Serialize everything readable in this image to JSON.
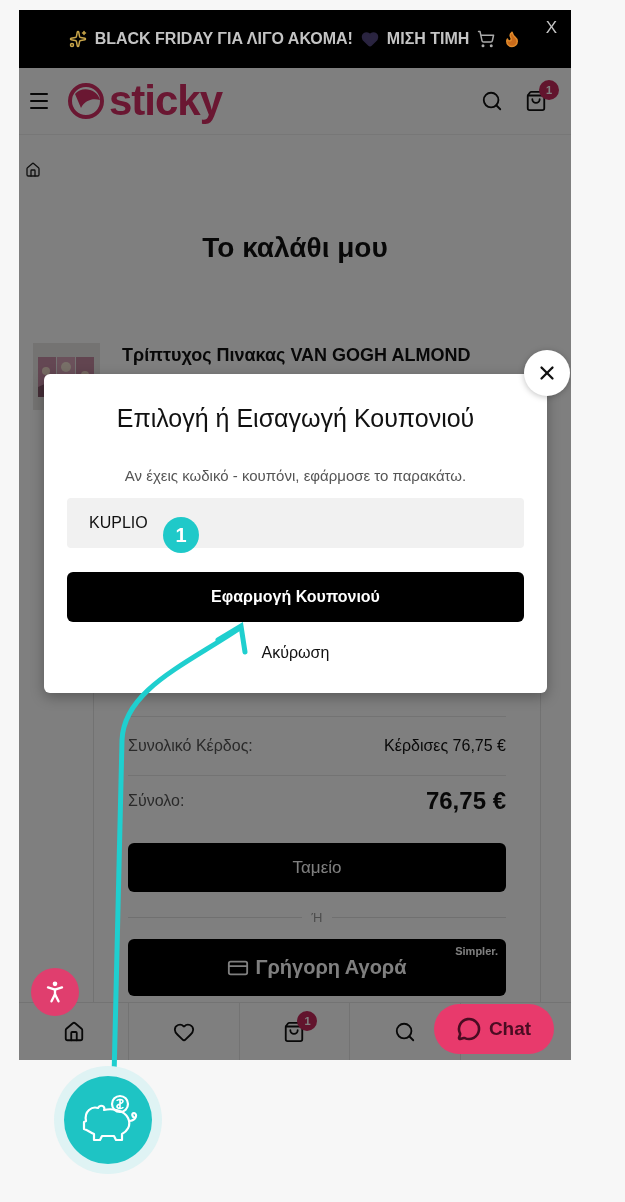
{
  "announcement": {
    "text": "BLACK FRIDAY ΓΙΑ ΛΙΓΟ ΑΚΟΜΑ!",
    "text_2": "ΜΙΣΗ ΤΙΜΗ",
    "close": "X"
  },
  "header": {
    "logo": "sticky",
    "cart_count": "1"
  },
  "page_title": "Το καλάθι μου",
  "product": {
    "title": "Τρίπτυχος Πινακας VAN GOGH ALMOND"
  },
  "summary": {
    "rows": [
      {
        "kind": "saving",
        "label": "Συνολικό Κέρδος:",
        "value": "Κέρδισες 76,75 €"
      },
      {
        "kind": "total",
        "label": "Σύνολο:",
        "value": "76,75 €"
      }
    ],
    "checkout": "Ταμείο",
    "separator": "Ή",
    "quick_buy": "Γρήγορη Αγορά",
    "quick_buy_brand": "Simpler."
  },
  "bottom_nav": [
    {
      "kind": "home"
    },
    {
      "kind": "wishlist"
    },
    {
      "kind": "cart",
      "badge": "1"
    },
    {
      "kind": "search"
    }
  ],
  "chat": "Chat",
  "modal": {
    "title": "Επιλογή ή Εισαγωγή Κουπονιού",
    "hint": "Αν έχεις κωδικό - κουπόνι, εφάρμοσε το παρακάτω.",
    "coupon_value": "KUPLIO",
    "apply": "Εφαρμογή Κουπονιού",
    "cancel": "Ακύρωση"
  },
  "annotation": {
    "step": "1"
  }
}
